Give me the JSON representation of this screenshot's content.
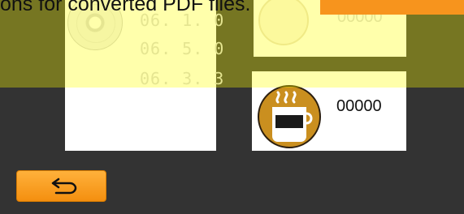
{
  "caption": {
    "text": "ons for converted PDF files."
  },
  "versions": [
    "06. 1. 0",
    "06. 5. 0",
    "06. 3. 3"
  ],
  "counter_faint": "00000",
  "counter": "00000",
  "icons": {
    "disc": "disc-icon",
    "cup": "coffee-cup-icon",
    "back": "return-arrow-icon"
  },
  "colors": {
    "highlight": "#ffff00",
    "accent": "#f7941d",
    "background": "#333333"
  }
}
